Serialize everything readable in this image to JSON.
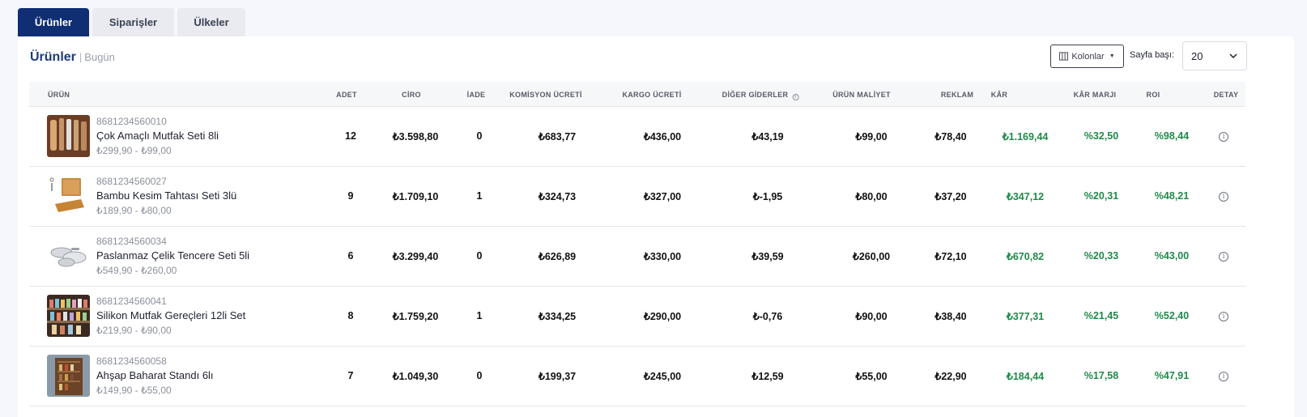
{
  "tabs": [
    {
      "label": "Ürünler"
    },
    {
      "label": "Siparişler"
    },
    {
      "label": "Ülkeler"
    }
  ],
  "card": {
    "title": "Ürünler",
    "separator": "|",
    "subtitle": "Bugün"
  },
  "toolbar": {
    "columns_label": "Kolonlar",
    "columns_icon": "columns-icon",
    "per_page_label": "Sayfa başı:",
    "per_page_value": "20"
  },
  "columns": {
    "product": "ÜRÜN",
    "qty": "ADET",
    "revenue": "CİRO",
    "returns": "İADE",
    "commission": "KOMİSYON ÜCRETİ",
    "shipping": "KARGO ÜCRETİ",
    "other": "DİĞER GİDERLER",
    "cost": "ÜRÜN MALİYET",
    "ads": "REKLAM",
    "profit": "KÂR",
    "margin": "KÂR MARJI",
    "roi": "ROI",
    "detail": "DETAY"
  },
  "rows": [
    {
      "barcode": "8681234560010",
      "name": "Çok Amaçlı Mutfak Seti 8li",
      "price_range": "₺299,90 - ₺99,00",
      "qty": "12",
      "revenue": "₺3.598,80",
      "returns": "0",
      "commission": "₺683,77",
      "shipping": "₺436,00",
      "other": "₺43,19",
      "cost": "₺99,00",
      "ads": "₺78,40",
      "profit": "₺1.169,44",
      "margin": "%32,50",
      "roi": "%98,44"
    },
    {
      "barcode": "8681234560027",
      "name": "Bambu Kesim Tahtası Seti 3lü",
      "price_range": "₺189,90 - ₺80,00",
      "qty": "9",
      "revenue": "₺1.709,10",
      "returns": "1",
      "commission": "₺324,73",
      "shipping": "₺327,00",
      "other": "₺-1,95",
      "cost": "₺80,00",
      "ads": "₺37,20",
      "profit": "₺347,12",
      "margin": "%20,31",
      "roi": "%48,21"
    },
    {
      "barcode": "8681234560034",
      "name": "Paslanmaz Çelik Tencere Seti 5li",
      "price_range": "₺549,90 - ₺260,00",
      "qty": "6",
      "revenue": "₺3.299,40",
      "returns": "0",
      "commission": "₺626,89",
      "shipping": "₺330,00",
      "other": "₺39,59",
      "cost": "₺260,00",
      "ads": "₺72,10",
      "profit": "₺670,82",
      "margin": "%20,33",
      "roi": "%43,00"
    },
    {
      "barcode": "8681234560041",
      "name": "Silikon Mutfak Gereçleri 12li Set",
      "price_range": "₺219,90 - ₺90,00",
      "qty": "8",
      "revenue": "₺1.759,20",
      "returns": "1",
      "commission": "₺334,25",
      "shipping": "₺290,00",
      "other": "₺-0,76",
      "cost": "₺90,00",
      "ads": "₺38,40",
      "profit": "₺377,31",
      "margin": "%21,45",
      "roi": "%52,40"
    },
    {
      "barcode": "8681234560058",
      "name": "Ahşap Baharat Standı 6lı",
      "price_range": "₺149,90 - ₺55,00",
      "qty": "7",
      "revenue": "₺1.049,30",
      "returns": "0",
      "commission": "₺199,37",
      "shipping": "₺245,00",
      "other": "₺12,59",
      "cost": "₺55,00",
      "ads": "₺22,90",
      "profit": "₺184,44",
      "margin": "%17,58",
      "roi": "%47,91"
    }
  ],
  "colors": {
    "accent": "#0f2e74",
    "positive": "#1f8a4a"
  }
}
